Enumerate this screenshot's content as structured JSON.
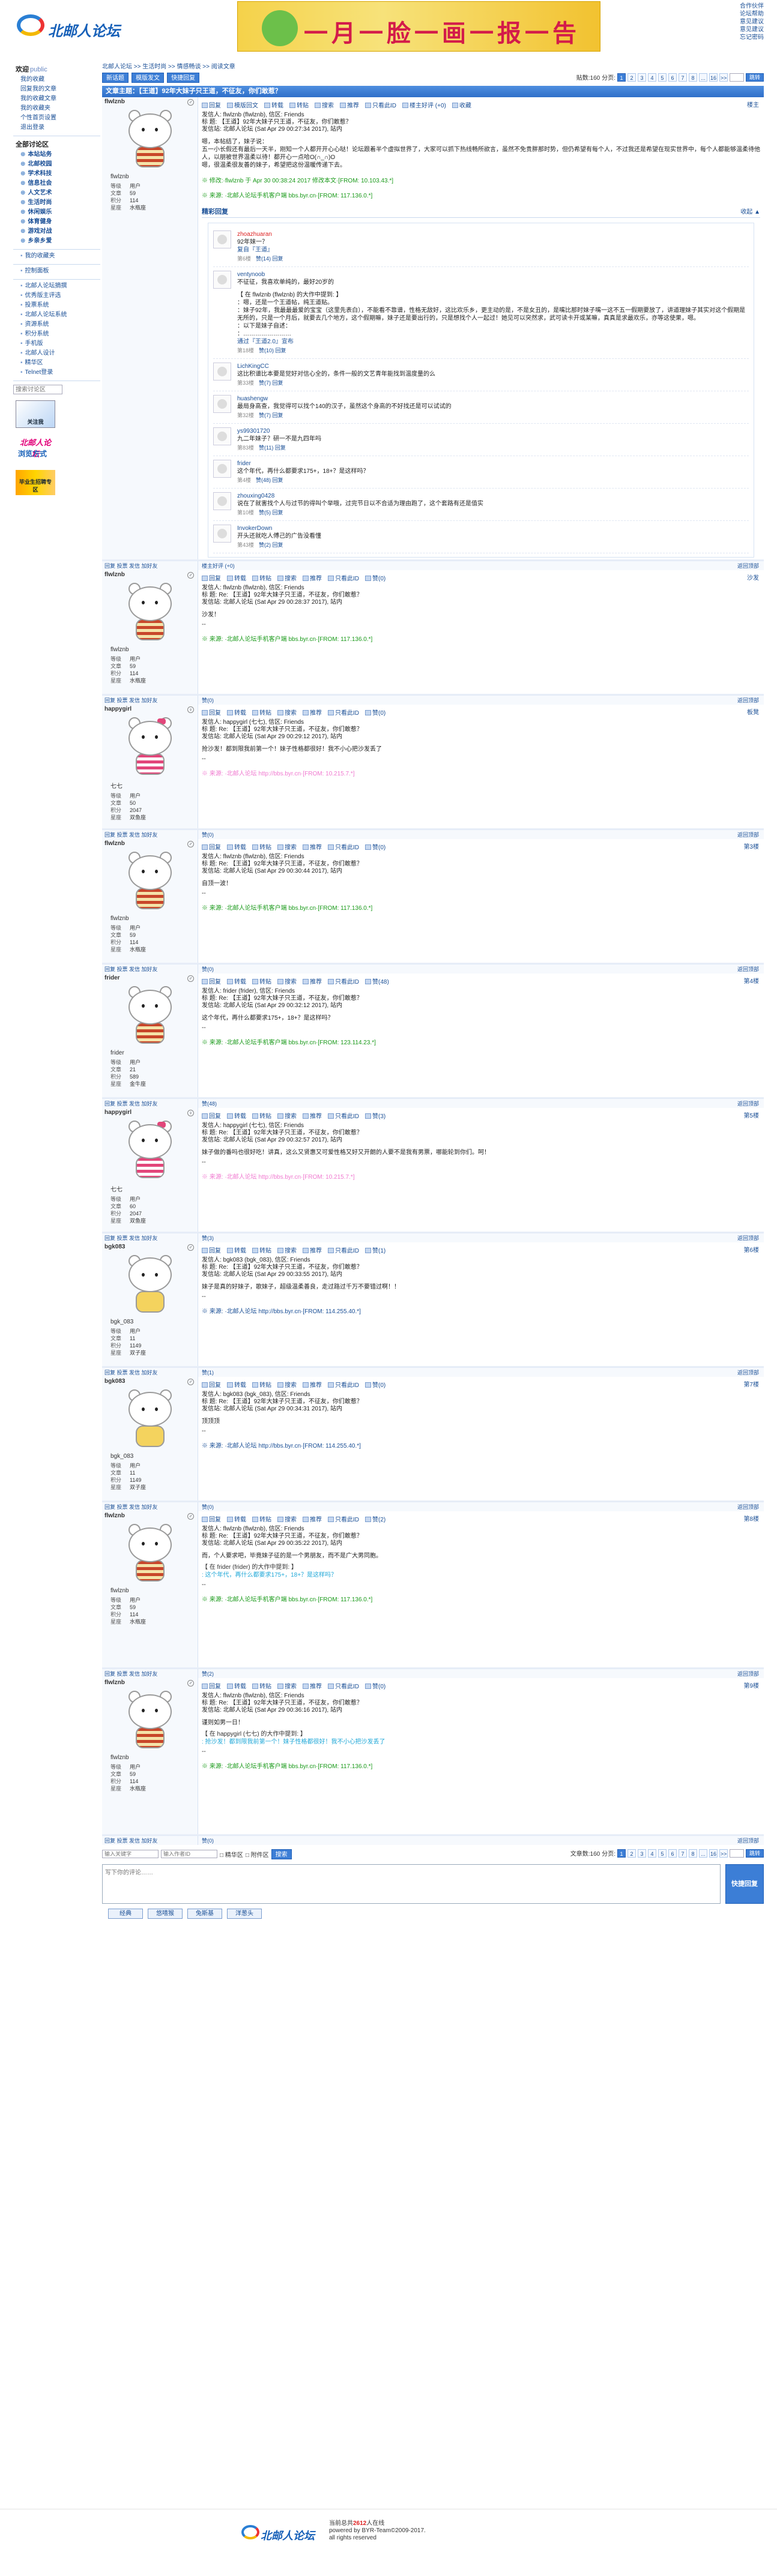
{
  "header": {
    "logo_text": "北邮人论坛",
    "banner_text": "一月一脸一画一报一告",
    "top_links": [
      "合作伙伴",
      "论坛帮助",
      "意见建议",
      "意见建议",
      "忘记密码"
    ]
  },
  "sidebar": {
    "welcome": "欢迎",
    "welcome_user": "public",
    "my_links": [
      "我的收藏",
      "回复我的文章",
      "我的收藏文章",
      "我的收藏夹",
      "个性首页设置",
      "退出登录"
    ],
    "sec2_head": "全部讨论区",
    "boards": [
      "本站站务",
      "北邮校园",
      "学术科技",
      "信息社会",
      "人文艺术",
      "生活时尚",
      "休闲娱乐",
      "体育健身",
      "游戏对战",
      "乡亲乡爱"
    ],
    "sec3_head": "我的收藏夹",
    "sec4_head": "控制面板",
    "others": [
      "北邮人论坛摘撰",
      "优秀版主评选",
      "投票系统",
      "北邮人论坛系统",
      "资源系统",
      "积分系统",
      "手机版",
      "北邮人设计",
      "精华区",
      "Telnet登录"
    ],
    "search_placeholder": "搜索讨论区",
    "promo1": "北邮人论坛",
    "promo1_btn": "关注我",
    "promo2_title": "北邮人论坛",
    "promo2_sub": "浏览方式",
    "promo3": "毕业生招聘专区"
  },
  "crumb": "北邮人论坛  >>  生活时尚  >>  情感畅谈  >>  阅读文章",
  "toolbar": {
    "new": "新话题",
    "mode": "模版发文",
    "quick": "快捷回复",
    "count": "贴数:160",
    "page_label": "分页:",
    "pages": [
      "1",
      "2",
      "3",
      "4",
      "5",
      "6",
      "7",
      "8",
      "...",
      "16"
    ],
    "go": ">>",
    "go2": "跳转"
  },
  "thread_title": "文章主题：【王道】92年大妹子只王道，不征友，你们敢惹？",
  "posts": [
    {
      "name": "flwlznb",
      "alias": "flwlznb",
      "gender": "♂",
      "avatar": "red",
      "stats": [
        "等级",
        "用户",
        "文章",
        "59",
        "积分",
        "114",
        "星座",
        "水瓶座"
      ],
      "floor": "楼主",
      "actions": [
        "回复",
        "模版回文",
        "转载",
        "转贴",
        "搜索",
        "推荐",
        "只看此ID",
        "楼主好评 (+0)",
        "收藏"
      ],
      "hdr": [
        "发信人: flwlznb (flwlznb), 信区: Friends",
        "标  题: 【王道】92年大妹子只王道，不征友，你们敢惹？",
        "发信站: 北邮人论坛 (Sat Apr 29 00:27:34 2017), 站内"
      ],
      "body": [
        "嗯，本帖结了，妹子说：",
        "    五一小长假还有最后一天半，刚知一个人都开开心心哒！论坛跟着半个虚拟世界了，大家可以抓下热线畅所欲言，虽然不免贵胖那时势，但仍希望有每个人，不过我还是希望在现实世界中，每个人都能够温柔待他人，以朋被世界温柔以待！都开心一点哈O(∩_∩)O",
        "    嗯，很温柔很友善的妹子，希望把这份温暖传递下去。"
      ],
      "edit": "※ 修改:·flwlznb 于 Apr 30 00:38:24 2017 修改本文·[FROM: 10.103.43.*]",
      "src": "※ 来源: ·北邮人论坛手机客户端 bbs.byr.cn·[FROM: 117.136.0.*]",
      "src_class": "",
      "foot_l": "回复  投票  发信  加好友",
      "foot_m": "楼主好评 (+0)",
      "foot_top": "返回顶部"
    },
    {
      "name": "flwlznb",
      "alias": "flwlznb",
      "gender": "♂",
      "avatar": "red",
      "stats": [
        "等级",
        "用户",
        "文章",
        "59",
        "积分",
        "114",
        "星座",
        "水瓶座"
      ],
      "floor": "沙发",
      "actions": [
        "回复",
        "转载",
        "转贴",
        "搜索",
        "推荐",
        "只看此ID",
        "赞(0)"
      ],
      "hdr": [
        "发信人: flwlznb (flwlznb), 信区: Friends",
        "标  题: Re: 【王道】92年大妹子只王道，不征友，你们敢惹？",
        "发信站: 北邮人论坛 (Sat Apr 29 00:28:37 2017), 站内"
      ],
      "body": [
        "沙发！"
      ],
      "sig": "--",
      "src": "※ 来源: ·北邮人论坛手机客户端 bbs.byr.cn·[FROM: 117.136.0.*]",
      "src_class": "",
      "foot_l": "回复  投票  发信  加好友",
      "foot_m": "赞(0)",
      "foot_top": "返回顶部"
    },
    {
      "name": "happygirl",
      "alias": "七七",
      "gender": "♀",
      "avatar": "pink",
      "stats": [
        "等级",
        "用户",
        "文章",
        "50",
        "积分",
        "2047",
        "星座",
        "双鱼座"
      ],
      "floor": "板凳",
      "actions": [
        "回复",
        "转载",
        "转贴",
        "搜索",
        "推荐",
        "只看此ID",
        "赞(0)"
      ],
      "hdr": [
        "发信人: happygirl (七七), 信区: Friends",
        "标  题: Re: 【王道】92年大妹子只王道，不征友，你们敢惹？",
        "发信站: 北邮人论坛 (Sat Apr 29 00:29:12 2017), 站内"
      ],
      "body": [
        "抢沙发！都到限我前第一个！妹子性格都很好！我不小心把沙发丢了"
      ],
      "sig": "--",
      "src": "※ 来源: ·北邮人论坛 http://bbs.byr.cn·[FROM: 10.215.7.*]",
      "src_class": "pink",
      "foot_l": "回复  投票  发信  加好友",
      "foot_m": "赞(0)",
      "foot_top": "返回顶部"
    },
    {
      "name": "flwlznb",
      "alias": "flwlznb",
      "gender": "♂",
      "avatar": "red",
      "stats": [
        "等级",
        "用户",
        "文章",
        "59",
        "积分",
        "114",
        "星座",
        "水瓶座"
      ],
      "floor": "第3楼",
      "actions": [
        "回复",
        "转载",
        "转贴",
        "搜索",
        "推荐",
        "只看此ID",
        "赞(0)"
      ],
      "hdr": [
        "发信人: flwlznb (flwlznb), 信区: Friends",
        "标  题: Re: 【王道】92年大妹子只王道，不征友，你们敢惹？",
        "发信站: 北邮人论坛 (Sat Apr 29 00:30:44 2017), 站内"
      ],
      "body": [
        "自顶一波！"
      ],
      "sig": "--",
      "src": "※ 来源: ·北邮人论坛手机客户端 bbs.byr.cn·[FROM: 117.136.0.*]",
      "src_class": "",
      "foot_l": "回复  投票  发信  加好友",
      "foot_m": "赞(0)",
      "foot_top": "返回顶部"
    },
    {
      "name": "frider",
      "alias": "frider",
      "gender": "♂",
      "avatar": "red",
      "stats": [
        "等级",
        "用户",
        "文章",
        "21",
        "积分",
        "589",
        "星座",
        "金牛座"
      ],
      "floor": "第4楼",
      "actions": [
        "回复",
        "转载",
        "转贴",
        "搜索",
        "推荐",
        "只看此ID",
        "赞(48)"
      ],
      "hdr": [
        "发信人: frider (frider), 信区: Friends",
        "标  题: Re: 【王道】92年大妹子只王道，不征友，你们敢惹？",
        "发信站: 北邮人论坛 (Sat Apr 29 00:32:12 2017), 站内"
      ],
      "body": [
        "这个年代，再什么都要求175+，18+？是这样吗？"
      ],
      "sig": "--",
      "src": "※ 来源: ·北邮人论坛手机客户端 bbs.byr.cn·[FROM: 123.114.23.*]",
      "src_class": "",
      "foot_l": "回复  投票  发信  加好友",
      "foot_m": "赞(48)",
      "foot_top": "返回顶部"
    },
    {
      "name": "happygirl",
      "alias": "七七",
      "gender": "♀",
      "avatar": "pink",
      "stats": [
        "等级",
        "用户",
        "文章",
        "60",
        "积分",
        "2047",
        "星座",
        "双鱼座"
      ],
      "floor": "第5楼",
      "actions": [
        "回复",
        "转载",
        "转贴",
        "搜索",
        "推荐",
        "只看此ID",
        "赞(3)"
      ],
      "hdr": [
        "发信人: happygirl (七七), 信区: Friends",
        "标  题: Re: 【王道】92年大妹子只王道，不征友，你们敢惹？",
        "发信站: 北邮人论坛 (Sat Apr 29 00:32:57 2017), 站内"
      ],
      "body": [
        "妹子做的番吗也很好吃！讲真，这么又贤惠又可爱性格又好又开朗的人要不是我有男票，哪能轮到你们。呵！"
      ],
      "sig": "--",
      "src": "※ 来源: ·北邮人论坛 http://bbs.byr.cn·[FROM: 10.215.7.*]",
      "src_class": "pink",
      "foot_l": "回复  投票  发信  加好友",
      "foot_m": "赞(3)",
      "foot_top": "返回顶部"
    },
    {
      "name": "bgk083",
      "alias": "bgk_083",
      "gender": "♂",
      "avatar": "yellow",
      "stats": [
        "等级",
        "用户",
        "文章",
        "11",
        "积分",
        "1149",
        "星座",
        "双子座"
      ],
      "floor": "第6楼",
      "actions": [
        "回复",
        "转载",
        "转贴",
        "搜索",
        "推荐",
        "只看此ID",
        "赞(1)"
      ],
      "hdr": [
        "发信人: bgk083 (bgk_083), 信区: Friends",
        "标  题: Re: 【王道】92年大妹子只王道，不征友，你们敢惹？",
        "发信站: 北邮人论坛 (Sat Apr 29 00:33:55 2017), 站内"
      ],
      "body": [
        "妹子是真的好妹子，歌妹子，超级温柔善良，走过路过千万不要错过啊！！"
      ],
      "sig": "--",
      "src": "※ 来源: ·北邮人论坛 http://bbs.byr.cn·[FROM: 114.255.40.*]",
      "src_class": "blue",
      "foot_l": "回复  投票  发信  加好友",
      "foot_m": "赞(1)",
      "foot_top": "返回顶部"
    },
    {
      "name": "bgk083",
      "alias": "bgk_083",
      "gender": "♂",
      "avatar": "yellow",
      "stats": [
        "等级",
        "用户",
        "文章",
        "11",
        "积分",
        "1149",
        "星座",
        "双子座"
      ],
      "floor": "第7楼",
      "actions": [
        "回复",
        "转载",
        "转贴",
        "搜索",
        "推荐",
        "只看此ID",
        "赞(0)"
      ],
      "hdr": [
        "发信人: bgk083 (bgk_083), 信区: Friends",
        "标  题: Re: 【王道】92年大妹子只王道，不征友，你们敢惹？",
        "发信站: 北邮人论坛 (Sat Apr 29 00:34:31 2017), 站内"
      ],
      "body": [
        "顶顶顶"
      ],
      "sig": "--",
      "src": "※ 来源: ·北邮人论坛 http://bbs.byr.cn·[FROM: 114.255.40.*]",
      "src_class": "blue",
      "foot_l": "回复  投票  发信  加好友",
      "foot_m": "赞(0)",
      "foot_top": "返回顶部"
    },
    {
      "name": "flwlznb",
      "alias": "flwlznb",
      "gender": "♂",
      "avatar": "red",
      "stats": [
        "等级",
        "用户",
        "文章",
        "59",
        "积分",
        "114",
        "星座",
        "水瓶座"
      ],
      "floor": "第8楼",
      "actions": [
        "回复",
        "转载",
        "转贴",
        "搜索",
        "推荐",
        "只看此ID",
        "赞(2)"
      ],
      "hdr": [
        "发信人: flwlznb (flwlznb), 信区: Friends",
        "标  题: Re: 【王道】92年大妹子只王道，不征友，你们敢惹？",
        "发信站: 北邮人论坛 (Sat Apr 29 00:35:22 2017), 站内"
      ],
      "body": [
        "而，个人要求吧，毕竟妹子征的是一个男朋友，而不是广大男同胞。"
      ],
      "quote_h": "【 在 frider (frider) 的大作中提到: 】",
      "quote_b": ": 这个年代，再什么都要求175+，18+？是这样吗？",
      "sig": "--",
      "src": "※ 来源: ·北邮人论坛手机客户端 bbs.byr.cn·[FROM: 117.136.0.*]",
      "src_class": "",
      "foot_l": "回复  投票  发信  加好友",
      "foot_m": "赞(2)",
      "foot_top": "返回顶部"
    },
    {
      "name": "flwlznb",
      "alias": "flwlznb",
      "gender": "♂",
      "avatar": "red",
      "stats": [
        "等级",
        "用户",
        "文章",
        "59",
        "积分",
        "114",
        "星座",
        "水瓶座"
      ],
      "floor": "第9楼",
      "actions": [
        "回复",
        "转载",
        "转贴",
        "搜索",
        "推荐",
        "只看此ID",
        "赞(0)"
      ],
      "hdr": [
        "发信人: flwlznb (flwlznb), 信区: Friends",
        "标  题: Re: 【王道】92年大妹子只王道，不征友，你们敢惹？",
        "发信站: 北邮人论坛 (Sat Apr 29 00:36:16 2017), 站内"
      ],
      "body": [
        "谨则如男一日！"
      ],
      "quote_h": "【 在 happygirl (七七) 的大作中提到: 】",
      "quote_b": ": 抢沙发！都到限我前第一个！妹子性格都很好！我不小心把沙发丢了",
      "sig": "--",
      "src": "※ 来源: ·北邮人论坛手机客户端 bbs.byr.cn·[FROM: 117.136.0.*]",
      "src_class": "",
      "foot_l": "回复  投票  发信  加好友",
      "foot_m": "赞(0)",
      "foot_top": "返回顶部"
    }
  ],
  "replies_section": {
    "title": "精彩回复",
    "more": "收起 ▲",
    "items": [
      {
        "name": "zhoazhuaran",
        "red": true,
        "lines": [
          "92年妹一？"
        ],
        "link": "复自『王道』",
        "meta_t": "第6楼",
        "meta": "赞(14)  回复"
      },
      {
        "name": "ventynoob",
        "red": false,
        "lines": [
          "不征征，我喜欢单纯的，最好20岁的",
          "",
          "【 在 flwlznb (flwlznb) 的大作中提到: 】",
          "：嗯，还是一个王道帖，纯王道贴。",
          "：妹子92年，我最最最爱的宝宝（这里先表白），不能看不靠谱，性格无敌好，这比欢乐乡，更主动的是，不是女丑的，是嘴比那时妹子嘴一这不五一假期要放了，讲道理妹子其实对这个假期是无所的，只是一个月后，就要去几个地方，这个假期嘛，妹子还是要出行的，只是想找个人一起过！她见可以突然求，武可读卡开或某嘛，真真是求最欢乐，亦等这使果，嗯。",
          "：以下是妹子自述：",
          "：……………………"
        ],
        "link": "通过『王道2.0』宣布",
        "meta_t": "第18楼",
        "meta": "赞(10)  回复"
      },
      {
        "name": "LichKingCC",
        "red": false,
        "lines": [
          "这比积谱比本要是觉好对信心全的，条件一般的文艺青年能找到温度量的么"
        ],
        "link": "",
        "meta_t": "第33楼",
        "meta": "赞(7)  回复"
      },
      {
        "name": "huashengw",
        "red": false,
        "lines": [
          "最局身高查，我觉得可以找个140的汉子，虽然这个身高的不好找还是可以试试的"
        ],
        "link": "",
        "meta_t": "第32楼",
        "meta": "赞(7)  回复"
      },
      {
        "name": "ys99301720",
        "red": false,
        "lines": [
          "九二年妹子？研一不是九四年吗"
        ],
        "link": "",
        "meta_t": "第83楼",
        "meta": "赞(11)  回复"
      },
      {
        "name": "frider",
        "red": false,
        "lines": [
          "这个年代，再什么都要求175+，18+？是这样吗？"
        ],
        "link": "",
        "meta_t": "第4楼",
        "meta": "赞(48)  回复"
      },
      {
        "name": "zhouxing0428",
        "red": false,
        "lines": [
          "说在了就害找个人与过节的得叫个举哦，过完节日以不合适为理由跑了，这个套路有还是值实"
        ],
        "link": "",
        "meta_t": "第10楼",
        "meta": "赞(5)  回复"
      },
      {
        "name": "InvokerDown",
        "red": false,
        "lines": [
          "开头还就吃人傅己的广告没看懂"
        ],
        "link": "",
        "meta_t": "第43楼",
        "meta": "赞(2)  回复"
      }
    ]
  },
  "bottom": {
    "count": "文章数:160",
    "page_label": "分页:",
    "kw_placeholder": "输入关键字",
    "author_placeholder": "输入作者ID",
    "opt1": "精华区",
    "opt2": "附件区",
    "search": "搜索"
  },
  "editor": {
    "placeholder": "写下你的评论……",
    "send": "快捷回复"
  },
  "emoji_tabs": [
    "经典",
    "悠嘻猴",
    "兔斯基",
    "洋葱头"
  ],
  "footer": {
    "logo": "北邮人论坛",
    "line1_pre": "当前总共",
    "online": "2612",
    "line1_post": "人在线",
    "line2": "powered by BYR-Team©2009-2017.",
    "line3": "all rights reserved"
  }
}
